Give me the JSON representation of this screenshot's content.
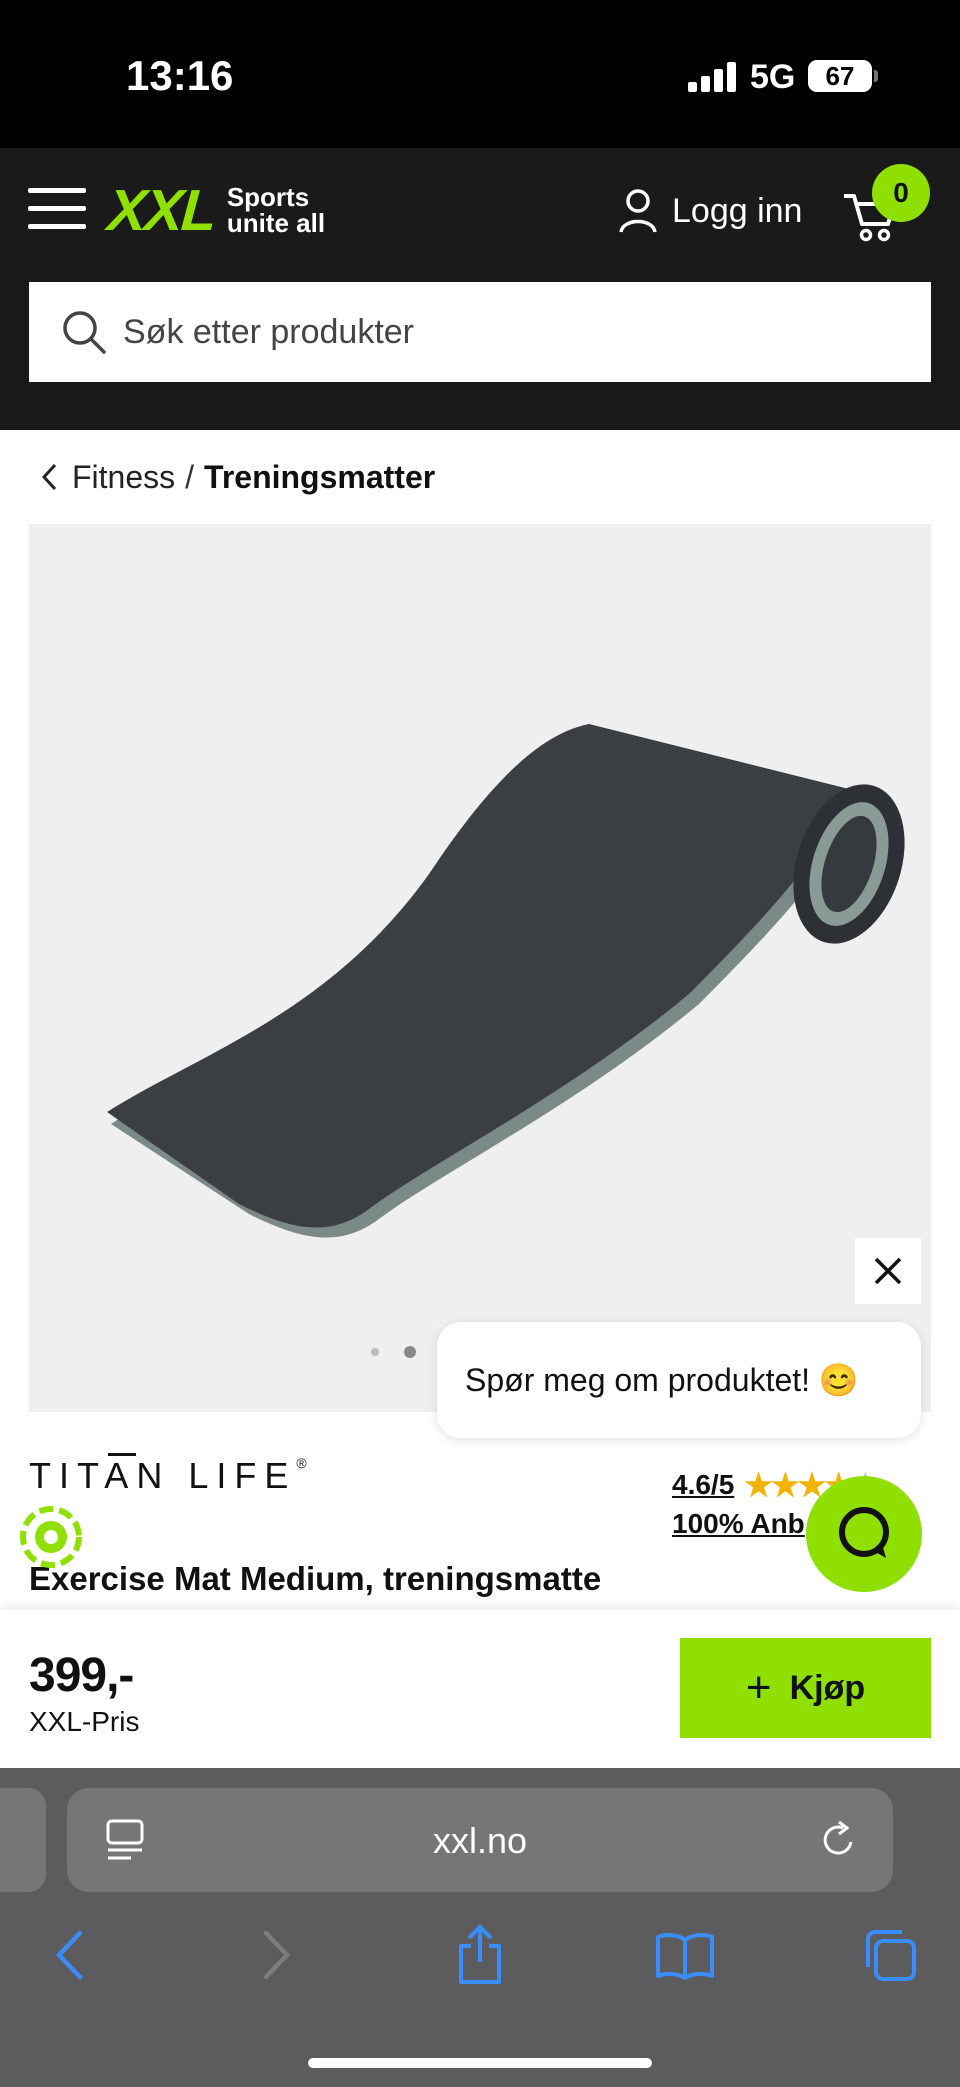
{
  "status_bar": {
    "time": "13:16",
    "network": "5G",
    "battery": "67"
  },
  "header": {
    "logo_text": "XXL",
    "logo_tagline_1": "Sports",
    "logo_tagline_2": "unite all",
    "login_label": "Logg inn",
    "cart_count": "0",
    "search_placeholder": "Søk etter produkter"
  },
  "breadcrumb": {
    "parent": "Fitness",
    "separator": "/",
    "current": "Treningsmatter"
  },
  "product": {
    "brand": "TITAN LIFE",
    "brand_mark": "®",
    "rating": "4.6/5",
    "rating_value": 4.6,
    "recommend": "100% Anb",
    "title": "Exercise Mat Medium, treningsmatte",
    "price": "399,-",
    "price_label": "XXL-Pris",
    "image_count": 2,
    "active_image": 2
  },
  "chat": {
    "message": "Spør meg om produktet! 😊"
  },
  "buy": {
    "label": "Kjøp"
  },
  "browser": {
    "url": "xxl.no"
  },
  "colors": {
    "accent": "#8fe000",
    "header_bg": "#1a1a1a",
    "safari_bg": "#5c5c5e",
    "ios_blue": "#3a8dff"
  }
}
